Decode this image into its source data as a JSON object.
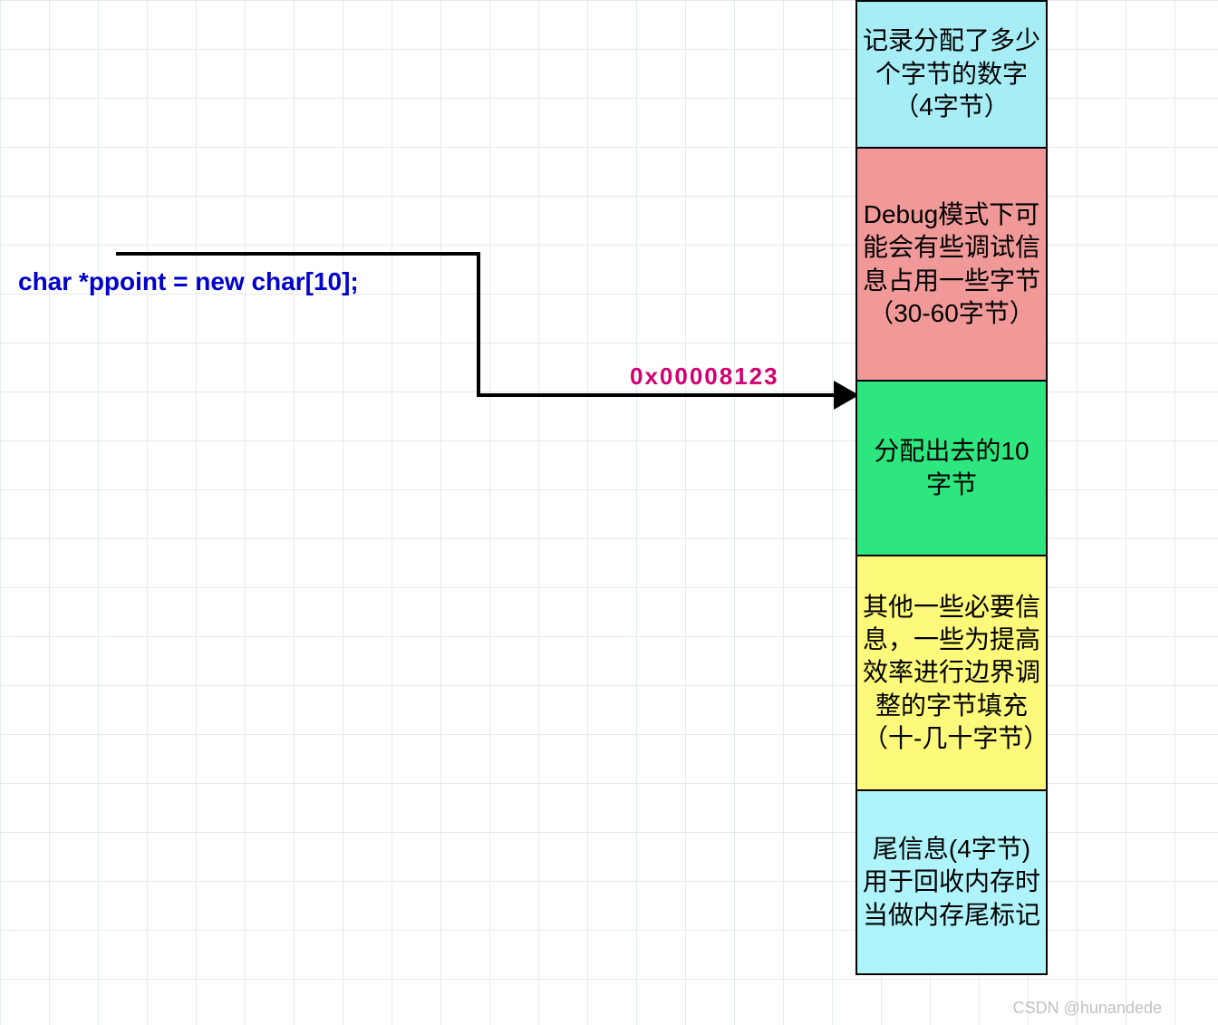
{
  "code_line": "char *ppoint = new char[10];",
  "address_label": "0x00008123",
  "boxes": {
    "b1": "记录分配了多少个字节的数字（4字节）",
    "b2": "Debug模式下可能会有些调试信息占用一些字节（30-60字节）",
    "b3": "分配出去的10字节",
    "b4": "其他一些必要信息，一些为提高效率进行边界调整的字节填充（十-几十字节）",
    "b5": "尾信息(4字节)用于回收内存时当做内存尾标记"
  },
  "watermark": "CSDN @hunandede"
}
